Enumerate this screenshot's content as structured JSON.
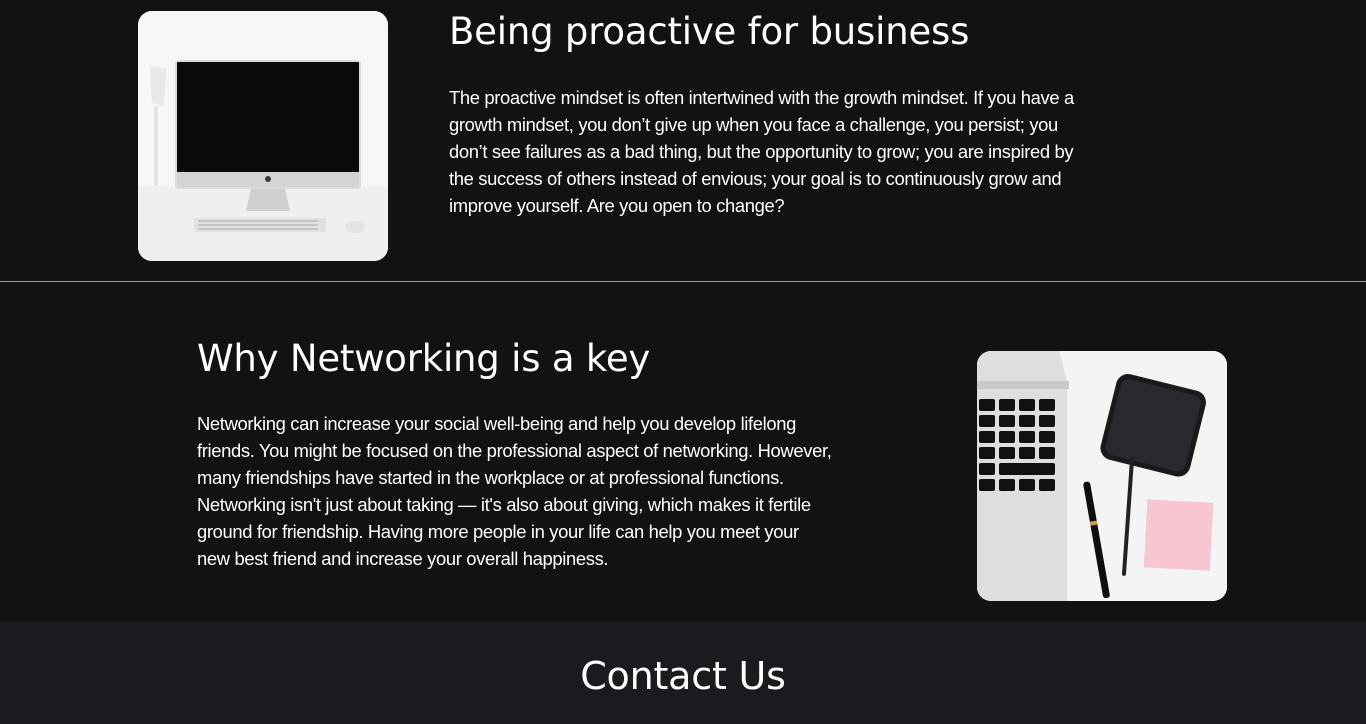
{
  "sections": [
    {
      "title": "Being proactive for business",
      "body": [
        "The proactive mindset is often intertwined with the growth mindset. If you have a",
        "growth mindset, you don’t give up when you face a challenge, you persist; you",
        "don’t see failures as a bad thing, but the opportunity to grow; you are inspired by",
        "the success of others instead of envious; your goal is to continuously grow and",
        "improve yourself. Are you open to change?"
      ],
      "image": "desktop-computer-photo"
    },
    {
      "title": "Why Networking is a key",
      "body": [
        "Networking can increase your social well-being and help you develop lifelong",
        "friends. You might be focused on the professional aspect of networking. However,",
        "many friendships have started in the workplace or at professional functions.",
        "Networking isn't just about taking — it's also about giving, which makes it fertile",
        "ground for friendship. Having more people in your life can help you meet your",
        "new best friend and increase your overall happiness."
      ],
      "image": "laptop-phone-pens-photo"
    }
  ],
  "contact": {
    "title": "Contact Us"
  },
  "colors": {
    "background": "#121113",
    "contact_background": "#1c1a1f",
    "divider": "#9a9a9a",
    "text": "#ffffff"
  }
}
